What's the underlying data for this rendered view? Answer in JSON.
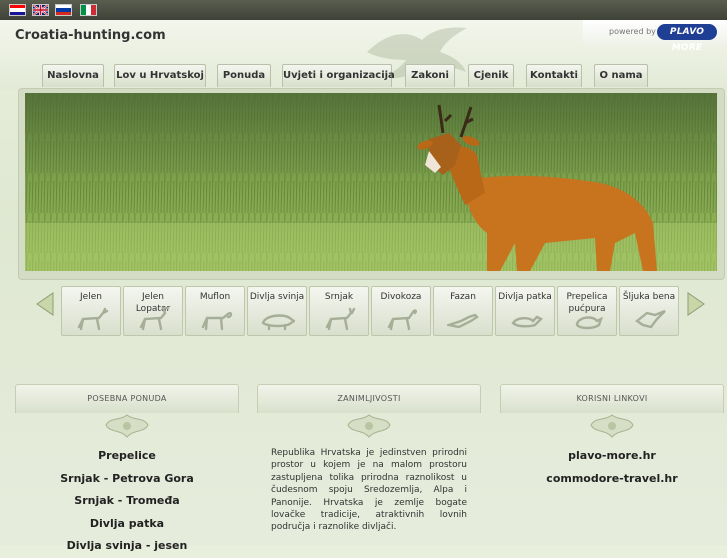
{
  "flags": [
    {
      "name": "croatia-flag",
      "colors": [
        "#ff0000",
        "#ffffff",
        "#171796"
      ]
    },
    {
      "name": "uk-flag",
      "colors": [
        "#012169",
        "#c8102e",
        "#012169"
      ]
    },
    {
      "name": "russia-flag",
      "colors": [
        "#ffffff",
        "#0039a6",
        "#d52b1e"
      ]
    },
    {
      "name": "italy-flag",
      "colors": [
        "#009246",
        "#ffffff",
        "#ce2b37"
      ]
    }
  ],
  "header": {
    "title": "Croatia-hunting.com",
    "powered_by": "powered by",
    "powered_logo": "PLAVO MORE"
  },
  "nav": [
    "Naslovna",
    "Lov u Hrvatskoj",
    "Ponuda",
    "Uvjeti i organizacija",
    "Zakoni",
    "Cjenik",
    "Kontakti",
    "O nama"
  ],
  "animals": [
    {
      "label": "Jelen",
      "icon": "deer-icon"
    },
    {
      "label": "Jelen Lopatar",
      "icon": "fallow-deer-icon"
    },
    {
      "label": "Muflon",
      "icon": "mouflon-icon"
    },
    {
      "label": "Divlja svinja",
      "icon": "boar-icon"
    },
    {
      "label": "Srnjak",
      "icon": "roebuck-icon"
    },
    {
      "label": "Divokoza",
      "icon": "chamois-icon"
    },
    {
      "label": "Fazan",
      "icon": "pheasant-icon"
    },
    {
      "label": "Divlja patka",
      "icon": "duck-icon"
    },
    {
      "label": "Prepelica pućpura",
      "icon": "quail-icon"
    },
    {
      "label": "Šljuka bena",
      "icon": "woodcock-icon"
    }
  ],
  "boxes": {
    "posebna": {
      "title": "POSEBNA PONUDA",
      "links": [
        "Prepelice",
        "Srnjak - Petrova Gora",
        "Srnjak - Tromeđa",
        "Divlja patka",
        "Divlja svinja - jesen"
      ]
    },
    "zanimljivosti": {
      "title": "ZANIMLJIVOSTI",
      "text": "Republika Hrvatska je jedinstven prirodni prostor u kojem je na malom prostoru zastupljena tolika prirodna raznolikost u čudesnom spoju Sredozemlja, Alpa i Panonije. Hrvatska je zemlje bogate lovačke tradicije, atraktivnih lovnih područja i raznolike divljači."
    },
    "linkovi": {
      "title": "KORISNI LINKOVI",
      "links": [
        "plavo-more.hr",
        "commodore-travel.hr"
      ]
    }
  }
}
